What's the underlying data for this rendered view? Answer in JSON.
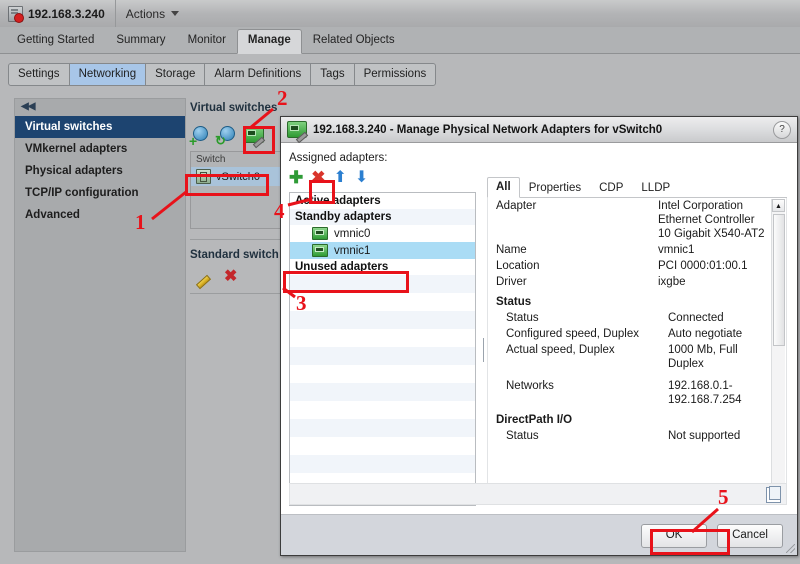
{
  "header": {
    "object_name": "192.168.3.240",
    "actions_label": "Actions",
    "host_icon": "host-icon",
    "caret_icon": "chevron-down-icon"
  },
  "primary_tabs": [
    {
      "label": "Getting Started",
      "active": false
    },
    {
      "label": "Summary",
      "active": false
    },
    {
      "label": "Monitor",
      "active": false
    },
    {
      "label": "Manage",
      "active": true
    },
    {
      "label": "Related Objects",
      "active": false
    }
  ],
  "secondary_tabs": [
    {
      "label": "Settings",
      "active": false
    },
    {
      "label": "Networking",
      "active": true
    },
    {
      "label": "Storage",
      "active": false
    },
    {
      "label": "Alarm Definitions",
      "active": false
    },
    {
      "label": "Tags",
      "active": false
    },
    {
      "label": "Permissions",
      "active": false
    }
  ],
  "sidebar": {
    "collapse_icon": "collapse-left-icon",
    "collapse_glyph": "◀◀",
    "items": [
      {
        "label": "Virtual switches",
        "active": true
      },
      {
        "label": "VMkernel adapters",
        "active": false
      },
      {
        "label": "Physical adapters",
        "active": false
      },
      {
        "label": "TCP/IP configuration",
        "active": false
      },
      {
        "label": "Advanced",
        "active": false
      }
    ]
  },
  "virtual_switches": {
    "title": "Virtual switches",
    "toolbar": [
      {
        "name": "add-host-networking-icon",
        "title": "Add host networking"
      },
      {
        "name": "refresh-icon",
        "title": "Refresh"
      },
      {
        "name": "manage-physical-adapters-icon",
        "title": "Manage physical network adapters"
      }
    ],
    "list_header": "Switch",
    "rows": [
      {
        "label": "vSwitch0",
        "selected": true
      }
    ],
    "standard_switch_title": "Standard switch: v",
    "detail_toolbar": [
      {
        "name": "edit-pencil-icon",
        "glyph": ""
      },
      {
        "name": "remove-x-icon",
        "glyph": "✖"
      }
    ]
  },
  "dialog": {
    "title": "192.168.3.240 - Manage Physical Network Adapters for vSwitch0",
    "title_icon": "manage-physical-adapters-icon",
    "help_glyph": "?",
    "assigned_label": "Assigned adapters:",
    "toolbar": [
      {
        "name": "add-adapter-icon",
        "glyph": "✚"
      },
      {
        "name": "remove-adapter-icon",
        "glyph": "✖"
      },
      {
        "name": "move-up-icon",
        "glyph": "⬆"
      },
      {
        "name": "move-down-icon",
        "glyph": "⬇"
      }
    ],
    "adapter_list": [
      {
        "type": "group",
        "label": "Active adapters",
        "alt": false
      },
      {
        "type": "group",
        "label": "Standby adapters",
        "alt": true
      },
      {
        "type": "item",
        "label": "vmnic0",
        "selected": false
      },
      {
        "type": "item",
        "label": "vmnic1",
        "selected": true
      },
      {
        "type": "group",
        "label": "Unused adapters",
        "alt": false
      }
    ],
    "detail_tabs": [
      {
        "label": "All",
        "active": true
      },
      {
        "label": "Properties",
        "active": false
      },
      {
        "label": "CDP",
        "active": false
      },
      {
        "label": "LLDP",
        "active": false
      }
    ],
    "details": [
      {
        "kind": "row",
        "key": "Adapter",
        "value": "Intel Corporation Ethernet Controller 10 Gigabit X540-AT2",
        "indent": false
      },
      {
        "kind": "row",
        "key": "Name",
        "value": "vmnic1",
        "indent": false
      },
      {
        "kind": "row",
        "key": "Location",
        "value": "PCI 0000:01:00.1",
        "indent": false
      },
      {
        "kind": "row",
        "key": "Driver",
        "value": "ixgbe",
        "indent": false
      },
      {
        "kind": "section",
        "key": "Status",
        "value": "",
        "indent": false
      },
      {
        "kind": "row",
        "key": "Status",
        "value": "Connected",
        "indent": true
      },
      {
        "kind": "row",
        "key": "Configured speed, Duplex",
        "value": "Auto negotiate",
        "indent": true
      },
      {
        "kind": "row",
        "key": "Actual speed, Duplex",
        "value": "1000 Mb, Full Duplex",
        "indent": true
      },
      {
        "kind": "row",
        "key": "Networks",
        "value": "192.168.0.1-192.168.7.254",
        "indent": true
      },
      {
        "kind": "section",
        "key": "DirectPath I/O",
        "value": "",
        "indent": false
      },
      {
        "kind": "row",
        "key": "Status",
        "value": "Not supported",
        "indent": true
      }
    ],
    "copy_icon": "copy-to-clipboard-icon",
    "buttons": {
      "ok": "OK",
      "cancel": "Cancel"
    },
    "scroll": {
      "up_glyph": "▲",
      "down_glyph": "▼"
    }
  },
  "annotations": [
    {
      "num": "1"
    },
    {
      "num": "2"
    },
    {
      "num": "3"
    },
    {
      "num": "4"
    },
    {
      "num": "5"
    }
  ],
  "colors": {
    "accent_blue": "#1d4470",
    "selection_blue": "#aadcf5",
    "annotation_red": "#e8121a",
    "tab_active_blue": "#a8c6e8"
  }
}
